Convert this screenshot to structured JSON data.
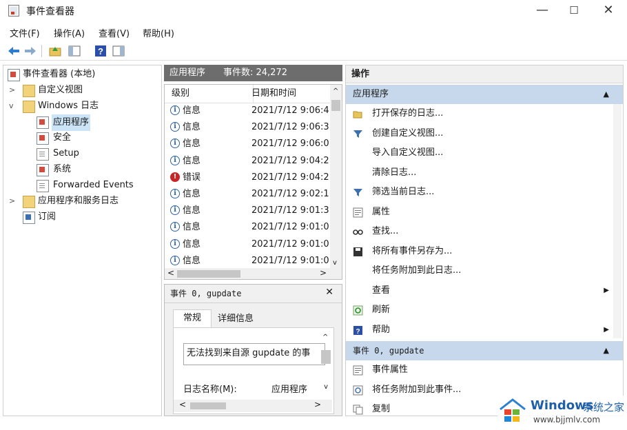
{
  "window": {
    "title": "事件查看器",
    "min_glyph": "—",
    "max_glyph": "☐",
    "close_glyph": "✕"
  },
  "menu": [
    "文件(F)",
    "操作(A)",
    "查看(V)",
    "帮助(H)"
  ],
  "tree": {
    "root": "事件查看器 (本地)",
    "custom_views": "自定义视图",
    "windows_logs": "Windows 日志",
    "application": "应用程序",
    "security": "安全",
    "setup": "Setup",
    "system": "系统",
    "forwarded": "Forwarded Events",
    "app_service_logs": "应用程序和服务日志",
    "subscriptions": "订阅"
  },
  "events_panel": {
    "log_name": "应用程序",
    "count_label": "事件数: 24,272",
    "columns": [
      "级别",
      "日期和时间"
    ],
    "rows": [
      {
        "level": "信息",
        "datetime": "2021/7/12 9:06:4",
        "type": "info"
      },
      {
        "level": "信息",
        "datetime": "2021/7/12 9:06:3",
        "type": "info"
      },
      {
        "level": "信息",
        "datetime": "2021/7/12 9:06:0",
        "type": "info"
      },
      {
        "level": "信息",
        "datetime": "2021/7/12 9:04:2",
        "type": "info"
      },
      {
        "level": "错误",
        "datetime": "2021/7/12 9:04:2",
        "type": "error"
      },
      {
        "level": "信息",
        "datetime": "2021/7/12 9:02:1",
        "type": "info"
      },
      {
        "level": "信息",
        "datetime": "2021/7/12 9:01:3",
        "type": "info"
      },
      {
        "level": "信息",
        "datetime": "2021/7/12 9:01:0",
        "type": "info"
      },
      {
        "level": "信息",
        "datetime": "2021/7/12 9:01:0",
        "type": "info"
      },
      {
        "level": "信息",
        "datetime": "2021/7/12 9:01:0",
        "type": "info"
      }
    ]
  },
  "detail": {
    "title": "事件 0, gupdate",
    "close_glyph": "✕",
    "tabs": [
      "常规",
      "详细信息"
    ],
    "message": "无法找到来自源 gupdate 的事",
    "log_name_label": "日志名称(M):",
    "log_name_value": "应用程序"
  },
  "actions": {
    "header": "操作",
    "section1": "应用程序",
    "items1": [
      {
        "label": "打开保存的日志...",
        "icon": "folder-open-icon"
      },
      {
        "label": "创建自定义视图...",
        "icon": "filter-icon"
      },
      {
        "label": "导入自定义视图...",
        "icon": ""
      },
      {
        "label": "清除日志...",
        "icon": ""
      },
      {
        "label": "筛选当前日志...",
        "icon": "filter-icon"
      },
      {
        "label": "属性",
        "icon": "properties-icon"
      },
      {
        "label": "查找...",
        "icon": "find-icon"
      },
      {
        "label": "将所有事件另存为...",
        "icon": "save-icon"
      },
      {
        "label": "将任务附加到此日志...",
        "icon": ""
      },
      {
        "label": "查看",
        "icon": "",
        "submenu": true
      },
      {
        "label": "刷新",
        "icon": "refresh-icon"
      },
      {
        "label": "帮助",
        "icon": "help-icon",
        "submenu": true
      }
    ],
    "section2": "事件 0, gupdate",
    "items2": [
      {
        "label": "事件属性",
        "icon": "properties-icon"
      },
      {
        "label": "将任务附加到此事件...",
        "icon": "task-icon"
      },
      {
        "label": "复制",
        "icon": "copy-icon"
      }
    ]
  },
  "watermark": {
    "brand": "Windows",
    "site_cn": "系统之家",
    "url": "www.bjjmlv.com"
  }
}
